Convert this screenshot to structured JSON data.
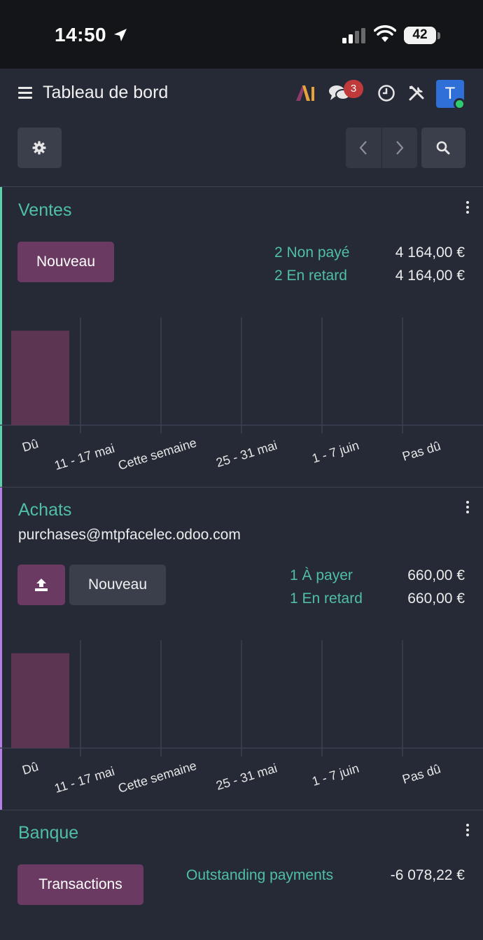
{
  "status_bar": {
    "time": "14:50",
    "battery": "42",
    "battery_level_percent": 42,
    "icons": [
      "location-arrow-icon",
      "signal-icon",
      "wifi-icon",
      "battery-icon"
    ]
  },
  "navbar": {
    "title": "Tableau de bord",
    "ai_label": "AI",
    "chat_badge": "3",
    "avatar_letter": "T",
    "icons": [
      "menu-icon",
      "ai-icon",
      "chat-icon",
      "clock-icon",
      "tools-icon"
    ]
  },
  "colors": {
    "background": "#262a36",
    "accent_teal": "#4fbfa6",
    "primary_button": "#6b3a62",
    "bar_fill": "#5b3552",
    "badge_red": "#c0393b",
    "avatar_blue": "#2e6fd8",
    "ventes_accent": "#5bd1a9",
    "achats_accent": "#b57fe6"
  },
  "ventes": {
    "title": "Ventes",
    "new_label": "Nouveau",
    "stats": [
      {
        "label": "2 Non payé",
        "amount": "4 164,00 €"
      },
      {
        "label": "2 En retard",
        "amount": "4 164,00 €"
      }
    ],
    "chart_data": {
      "type": "bar",
      "categories": [
        "Dû",
        "11 - 17 mai",
        "Cette semaine",
        "25 - 31 mai",
        "1 - 7 juin",
        "Pas dû"
      ],
      "values": [
        4164.0,
        0,
        0,
        0,
        0,
        0
      ],
      "ylim": [
        0,
        5000
      ],
      "grid": true
    }
  },
  "achats": {
    "title": "Achats",
    "email": "purchases@mtpfacelec.odoo.com",
    "upload_icon": "upload-icon",
    "new_label": "Nouveau",
    "stats": [
      {
        "label": "1 À payer",
        "amount": "660,00 €"
      },
      {
        "label": "1 En retard",
        "amount": "660,00 €"
      }
    ],
    "chart_data": {
      "type": "bar",
      "categories": [
        "Dû",
        "11 - 17 mai",
        "Cette semaine",
        "25 - 31 mai",
        "1 - 7 juin",
        "Pas dû"
      ],
      "values": [
        660.0,
        0,
        0,
        0,
        0,
        0
      ],
      "ylim": [
        0,
        790
      ],
      "grid": true
    }
  },
  "banque": {
    "title": "Banque",
    "transactions_label": "Transactions",
    "stats": [
      {
        "label": "Outstanding payments",
        "amount": "-6 078,22 €"
      }
    ]
  }
}
